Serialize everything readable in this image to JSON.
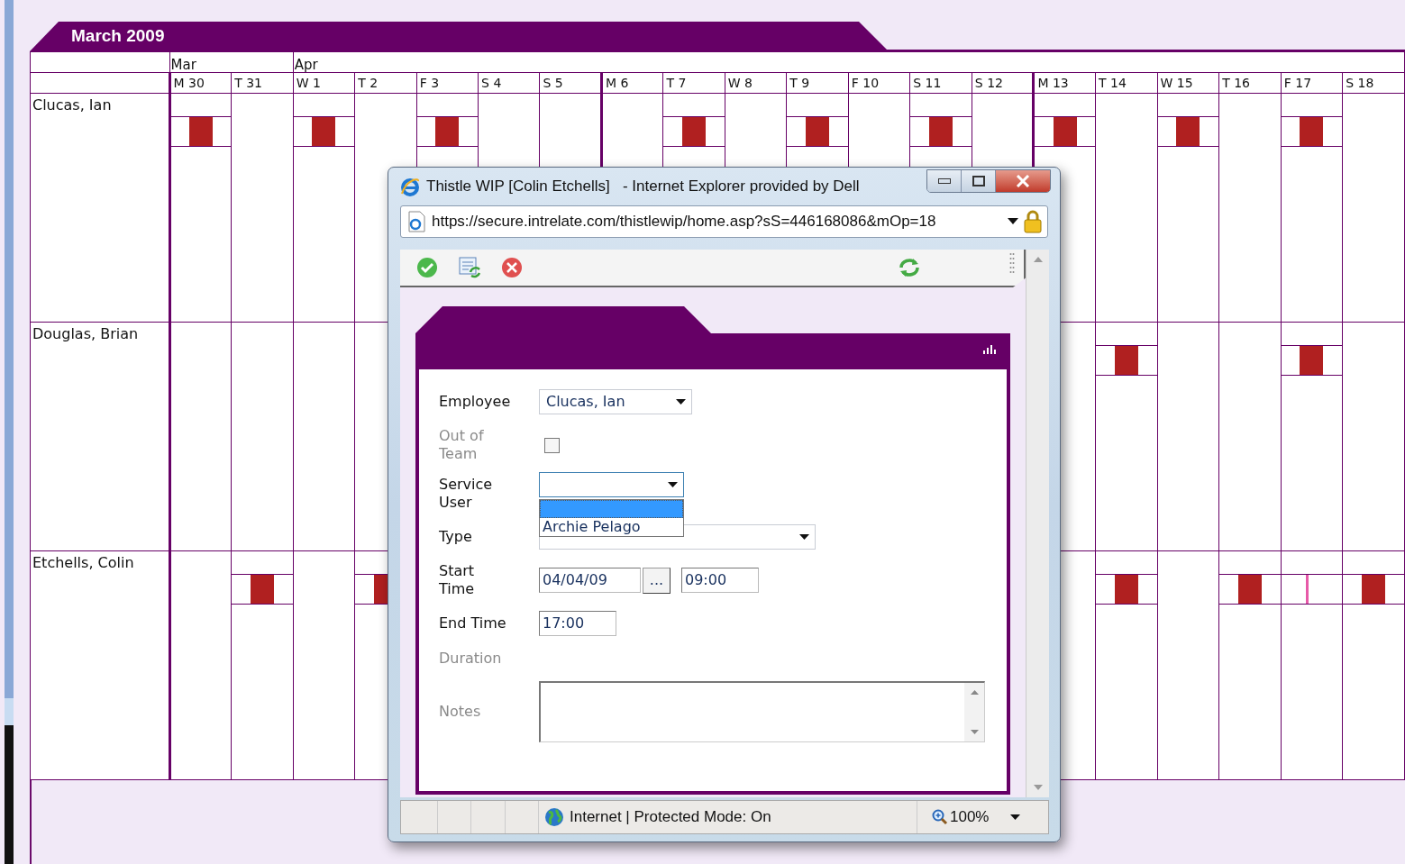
{
  "calendar": {
    "title": "March 2009",
    "months": [
      {
        "label": "Mar",
        "days": [
          {
            "label": "M 30",
            "week_start": true
          },
          {
            "label": "T 31",
            "week_start": false
          }
        ]
      },
      {
        "label": "Apr",
        "days": [
          {
            "label": "W 1",
            "week_start": false
          },
          {
            "label": "T 2",
            "week_start": false
          },
          {
            "label": "F 3",
            "week_start": false
          },
          {
            "label": "S 4",
            "week_start": false
          },
          {
            "label": "S 5",
            "week_start": false
          },
          {
            "label": "M 6",
            "week_start": true
          },
          {
            "label": "T 7",
            "week_start": false
          },
          {
            "label": "W 8",
            "week_start": false
          },
          {
            "label": "T 9",
            "week_start": false
          },
          {
            "label": "F 10",
            "week_start": false
          },
          {
            "label": "S 11",
            "week_start": false
          },
          {
            "label": "S 12",
            "week_start": false
          },
          {
            "label": "M 13",
            "week_start": true
          },
          {
            "label": "T 14",
            "week_start": false
          },
          {
            "label": "W 15",
            "week_start": false
          },
          {
            "label": "T 16",
            "week_start": false
          },
          {
            "label": "F 17",
            "week_start": false
          },
          {
            "label": "S 18",
            "week_start": false
          }
        ]
      }
    ],
    "employees": [
      {
        "name": "Clucas, Ian",
        "cells": [
          {
            "kind": "block"
          },
          {
            "kind": "empty"
          },
          {
            "kind": "block"
          },
          {
            "kind": "empty"
          },
          {
            "kind": "block"
          },
          {
            "kind": "empty"
          },
          {
            "kind": "empty"
          },
          {
            "kind": "empty"
          },
          {
            "kind": "block"
          },
          {
            "kind": "empty"
          },
          {
            "kind": "block"
          },
          {
            "kind": "empty"
          },
          {
            "kind": "block"
          },
          {
            "kind": "empty"
          },
          {
            "kind": "block"
          },
          {
            "kind": "empty"
          },
          {
            "kind": "block"
          },
          {
            "kind": "empty"
          },
          {
            "kind": "block"
          },
          {
            "kind": "empty"
          }
        ]
      },
      {
        "name": "Douglas, Brian",
        "cells": [
          {
            "kind": "empty"
          },
          {
            "kind": "empty"
          },
          {
            "kind": "empty"
          },
          {
            "kind": "empty"
          },
          {
            "kind": "empty"
          },
          {
            "kind": "empty"
          },
          {
            "kind": "empty"
          },
          {
            "kind": "empty"
          },
          {
            "kind": "empty"
          },
          {
            "kind": "empty"
          },
          {
            "kind": "empty"
          },
          {
            "kind": "empty"
          },
          {
            "kind": "empty"
          },
          {
            "kind": "empty"
          },
          {
            "kind": "empty"
          },
          {
            "kind": "block"
          },
          {
            "kind": "empty"
          },
          {
            "kind": "empty"
          },
          {
            "kind": "block"
          },
          {
            "kind": "empty"
          }
        ]
      },
      {
        "name": "Etchells, Colin",
        "cells": [
          {
            "kind": "empty"
          },
          {
            "kind": "block"
          },
          {
            "kind": "empty"
          },
          {
            "kind": "block"
          },
          {
            "kind": "empty"
          },
          {
            "kind": "empty"
          },
          {
            "kind": "empty"
          },
          {
            "kind": "empty"
          },
          {
            "kind": "empty"
          },
          {
            "kind": "empty"
          },
          {
            "kind": "empty"
          },
          {
            "kind": "empty"
          },
          {
            "kind": "empty"
          },
          {
            "kind": "empty"
          },
          {
            "kind": "empty"
          },
          {
            "kind": "block"
          },
          {
            "kind": "empty"
          },
          {
            "kind": "block"
          },
          {
            "kind": "line"
          },
          {
            "kind": "block"
          }
        ]
      }
    ]
  },
  "browser_window": {
    "title": "Thistle WIP [Colin Etchells]   - Internet Explorer provided by Dell",
    "url": "https://secure.intrelate.com/thistlewip/home.asp?sS=446168086&mOp=18",
    "status": "Internet | Protected Mode: On",
    "zoom": "100%",
    "form": [
      {
        "label": "Employee",
        "kind": "select",
        "value": "Clucas, Ian",
        "disabled": false
      },
      {
        "label": "Out of Team",
        "kind": "checkbox",
        "checked": false,
        "disabled": true
      },
      {
        "label": "Service User",
        "kind": "select_open",
        "disabled": false,
        "dropdown": {
          "blank_highlighted": true,
          "options": [
            {
              "label": "Archie Pelago",
              "selected": false
            }
          ]
        }
      },
      {
        "label": "Type",
        "kind": "select_wide",
        "disabled": false
      },
      {
        "label": "Start Time",
        "kind": "datetime",
        "date": "04/04/09",
        "button": "...",
        "time": "09:00",
        "disabled": false
      },
      {
        "label": "End Time",
        "kind": "time",
        "value": "17:00",
        "disabled": false
      },
      {
        "label": "Duration",
        "kind": "empty",
        "disabled": true
      },
      {
        "label": "Notes",
        "kind": "textarea",
        "disabled": true
      }
    ]
  }
}
